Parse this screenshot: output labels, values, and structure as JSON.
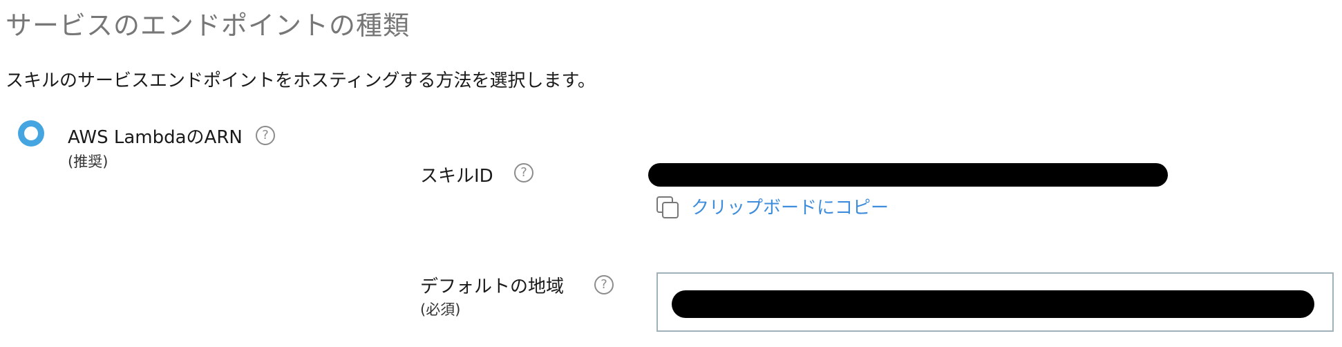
{
  "section": {
    "title": "サービスのエンドポイントの種類",
    "description": "スキルのサービスエンドポイントをホスティングする方法を選択します。"
  },
  "endpoint_option": {
    "label": "AWS LambdaのARN",
    "sub_label": "(推奨)",
    "selected": true,
    "help_glyph": "?"
  },
  "skill_id": {
    "label": "スキルID",
    "help_glyph": "?",
    "value": "",
    "copy_label": "クリップボードにコピー"
  },
  "default_region": {
    "label": "デフォルトの地域",
    "sub_label": "(必須)",
    "help_glyph": "?",
    "value": ""
  },
  "colors": {
    "radio_selected": "#44a5e0",
    "link": "#3e8ddd",
    "title": "#777777",
    "input_border": "#9eb0b8"
  },
  "icons": {
    "radio": "radio-selected-icon",
    "help": "help-circle-icon",
    "copy": "copy-icon"
  }
}
